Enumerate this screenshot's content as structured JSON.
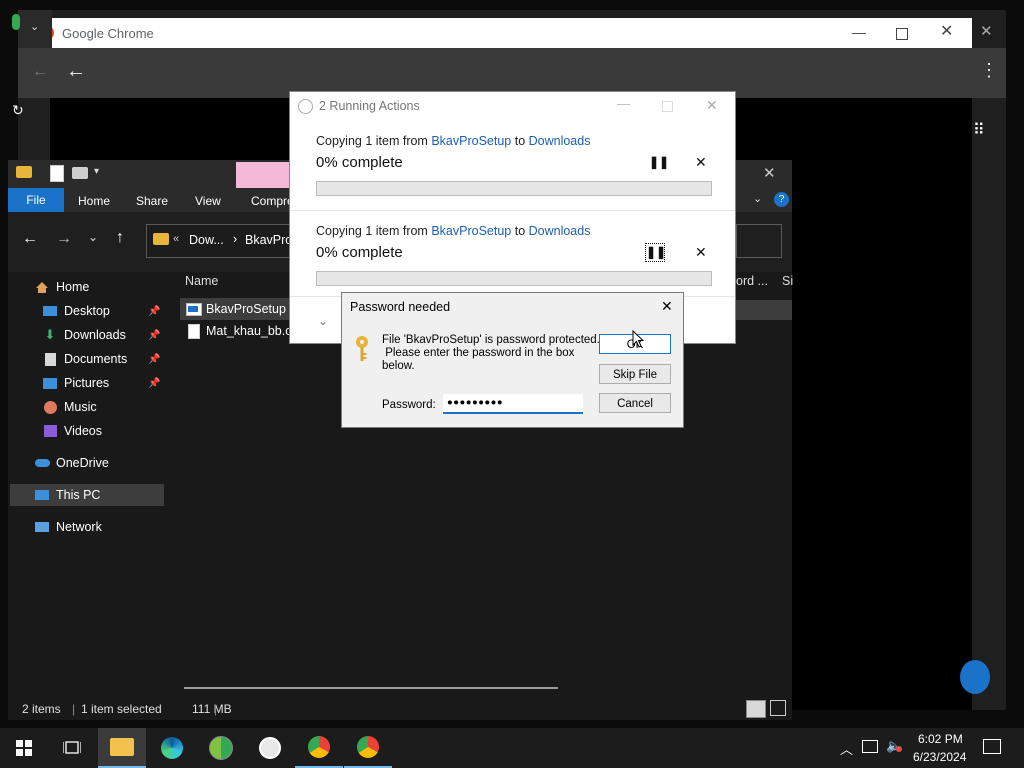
{
  "chrome": {
    "title": "Google Chrome"
  },
  "explorer": {
    "ribbon_tabs": {
      "file": "File",
      "home": "Home",
      "share": "Share",
      "view": "View",
      "compress": "Compre"
    },
    "address": {
      "part1": "Dow...",
      "sep": "›",
      "part2": "BkavPro"
    },
    "columns": {
      "name": "Name",
      "date_modified_partial": "ord ...",
      "size_partial": "Si"
    },
    "nav": {
      "home": "Home",
      "desktop": "Desktop",
      "downloads": "Downloads",
      "documents": "Documents",
      "pictures": "Pictures",
      "music": "Music",
      "videos": "Videos",
      "onedrive": "OneDrive",
      "this_pc": "This PC",
      "network": "Network"
    },
    "files": [
      {
        "name": "BkavProSetup"
      },
      {
        "name": "Mat_khau_bb.c"
      }
    ],
    "status": {
      "items": "2 items",
      "selected": "1 item selected",
      "size": "111 MB"
    }
  },
  "running_actions": {
    "title": "2 Running Actions",
    "jobs": [
      {
        "prefix": "Copying 1 item from ",
        "source": "BkavProSetup",
        "mid": " to ",
        "dest": "Downloads",
        "percent_label": "0% complete",
        "progress": 0
      },
      {
        "prefix": "Copying 1 item from ",
        "source": "BkavProSetup",
        "mid": " to ",
        "dest": "Downloads",
        "percent_label": "0% complete",
        "progress": 0
      }
    ]
  },
  "password_dialog": {
    "title": "Password needed",
    "message_l1": "File 'BkavProSetup' is password protected.",
    "message_l2": " Please enter the password in the box",
    "message_l3": "below.",
    "password_label": "Password:",
    "password_value": "●●●●●●●●●",
    "ok_label": "OK",
    "skip_label": "Skip File",
    "cancel_label": "Cancel"
  },
  "taskbar": {
    "time": "6:02 PM",
    "date": "6/23/2024"
  },
  "colors": {
    "accent": "#1a73c8",
    "link": "#1a5fb4"
  }
}
